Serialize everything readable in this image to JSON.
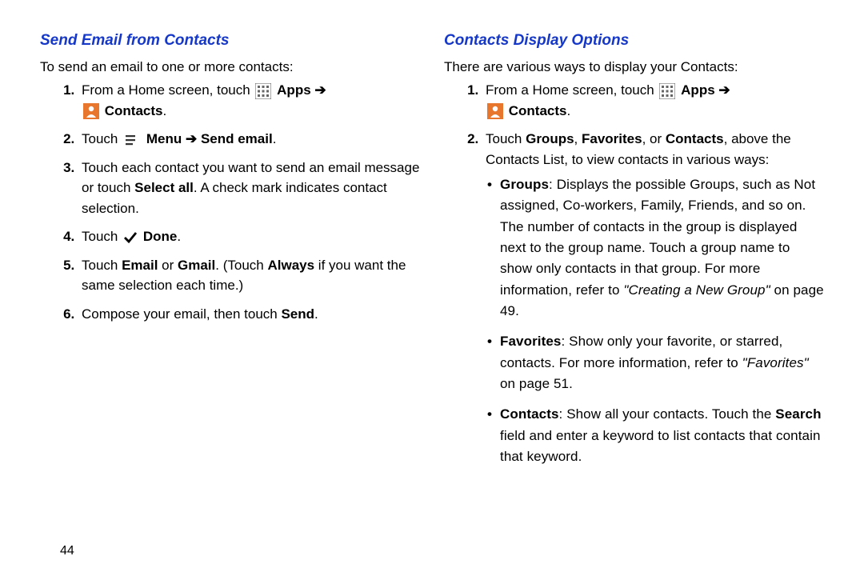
{
  "page_number": "44",
  "left": {
    "heading": "Send Email from Contacts",
    "intro": "To send an email to one or more contacts:",
    "step1_pre": "From a Home screen, touch ",
    "apps_label": "Apps",
    "contacts_label": "Contacts",
    "step2_touch": "Touch ",
    "menu_label": "Menu",
    "send_email_label": "Send email",
    "step3_a": "Touch each contact you want to send an email message or touch ",
    "select_all": "Select all",
    "step3_b": ". A check mark indicates contact selection.",
    "step4_touch": "Touch ",
    "done_label": "Done",
    "step5_a": "Touch ",
    "email_label": "Email",
    "or": " or ",
    "gmail_label": "Gmail",
    "step5_b": ". (Touch ",
    "always_label": "Always",
    "step5_c": " if you want the same selection each time.)",
    "step6_a": "Compose your email, then touch ",
    "send_label": "Send",
    "arrow": "➔",
    "period": "."
  },
  "right": {
    "heading": "Contacts Display Options",
    "intro": "There are various ways to display your Contacts:",
    "step1_pre": "From a Home screen, touch ",
    "apps_label": "Apps",
    "contacts_label": "Contacts",
    "step2_a": "Touch ",
    "groups": "Groups",
    "comma_sp": ", ",
    "favorites": "Favorites",
    "or": ", or ",
    "contacts": "Contacts",
    "step2_b": ", above the Contacts List, to view contacts in various ways:",
    "bullet_groups_label": "Groups",
    "bullet_groups_a": ": Displays the possible Groups, such as Not assigned, Co-workers, Family, Friends, and so on. The number of contacts in the group is displayed next to the group name. Touch a group name to show only contacts in that group. For more information, refer to ",
    "bullet_groups_ref": "\"Creating a New Group\"",
    "bullet_groups_b": " on page 49.",
    "bullet_fav_label": "Favorites",
    "bullet_fav_a": ": Show only your favorite, or starred, contacts. For more information, refer to ",
    "bullet_fav_ref": "\"Favorites\"",
    "bullet_fav_b": " on page 51.",
    "bullet_contacts_label": "Contacts",
    "bullet_contacts_a": ": Show all your contacts. Touch the ",
    "search_label": "Search",
    "bullet_contacts_b": " field and enter a keyword to list contacts that contain that keyword.",
    "arrow": "➔",
    "period": "."
  }
}
